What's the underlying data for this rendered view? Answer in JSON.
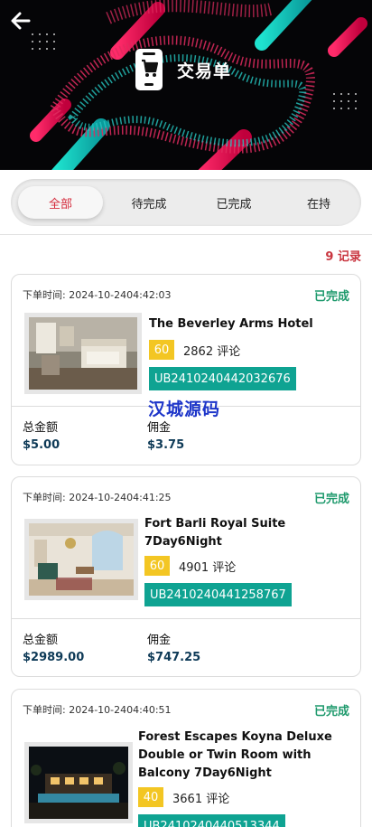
{
  "header": {
    "title": "交易单",
    "back_icon": "arrow-left-icon",
    "title_icon": "shopping-cart-phone-icon"
  },
  "tabs": [
    {
      "label": "全部",
      "active": true
    },
    {
      "label": "待完成",
      "active": false
    },
    {
      "label": "已完成",
      "active": false
    },
    {
      "label": "在持",
      "active": false
    }
  ],
  "record_count": "9 记录",
  "watermark": "汉城源码",
  "labels": {
    "total": "总金额",
    "commission": "佣金"
  },
  "orders": [
    {
      "time": "下单时间: 2024-10-2404:42:03",
      "status": "已完成",
      "hotel": "The Beverley Arms Hotel",
      "score": "60",
      "reviews": "2862 评论",
      "order_no": "UB2410240442032676",
      "total": "$5.00",
      "commission": "$3.75"
    },
    {
      "time": "下单时间: 2024-10-2404:41:25",
      "status": "已完成",
      "hotel_line1": "Fort Barli Royal Suite",
      "hotel_line2": "7Day6Night",
      "score": "60",
      "reviews": "4901 评论",
      "order_no": "UB2410240441258767",
      "total": "$2989.00",
      "commission": "$747.25"
    },
    {
      "time": "下单时间: 2024-10-2404:40:51",
      "status": "已完成",
      "hotel_line1": "Forest Escapes Koyna Deluxe",
      "hotel_line2": "Double or Twin Room with",
      "hotel_line3": "Balcony 7Day6Night",
      "score": "40",
      "reviews": "3661 评论",
      "order_no": "UB2410240440513344"
    }
  ],
  "colors": {
    "accent_red": "#d42a3b",
    "status_green": "#1f9a6d",
    "order_teal": "#0fa392",
    "score_yellow": "#f3c623",
    "amount_navy": "#0e3a57"
  }
}
